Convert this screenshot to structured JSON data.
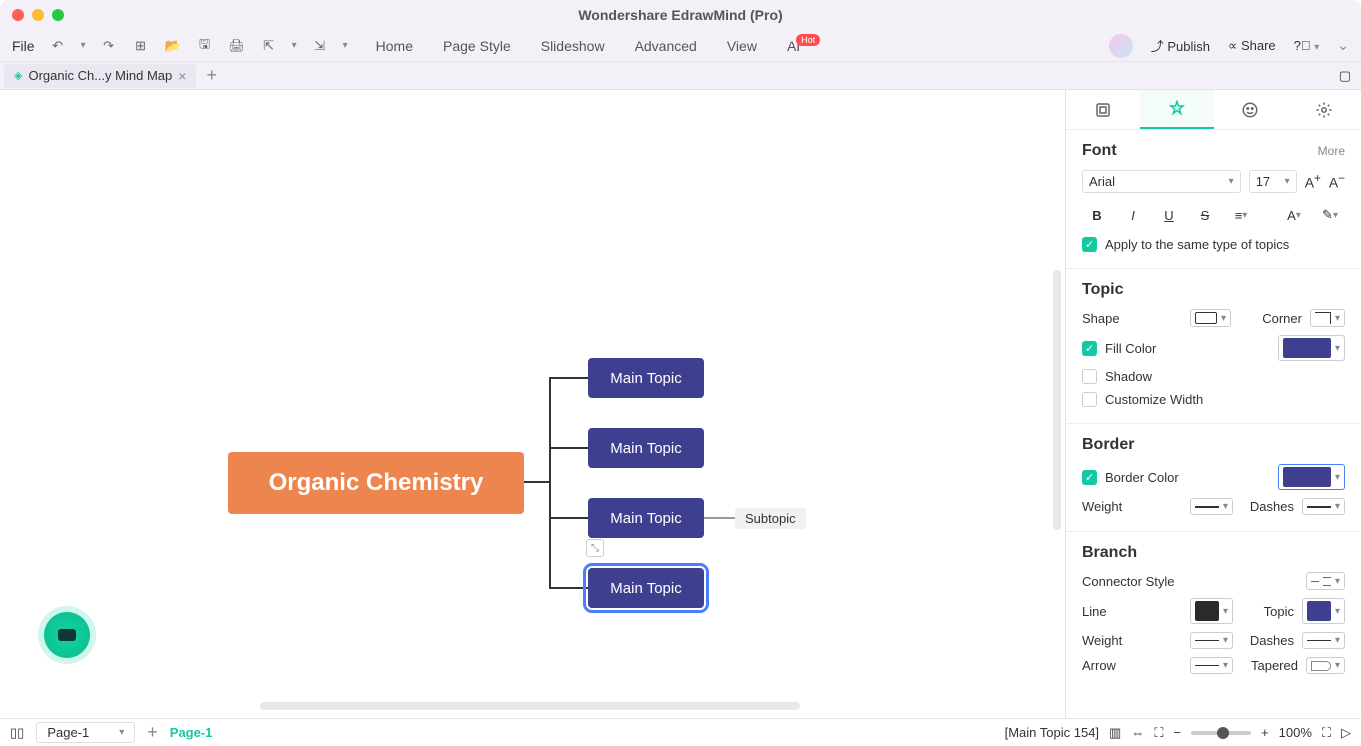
{
  "app": {
    "title": "Wondershare EdrawMind (Pro)"
  },
  "toolbar": {
    "file": "File",
    "menus": [
      "Home",
      "Page Style",
      "Slideshow",
      "Advanced",
      "View",
      "AI"
    ],
    "hot": "Hot",
    "publish": "Publish",
    "share": "Share"
  },
  "tabs": {
    "active": "Organic Ch...y Mind Map"
  },
  "mindmap": {
    "central": "Organic Chemistry",
    "topics": [
      "Main Topic",
      "Main Topic",
      "Main Topic",
      "Main Topic"
    ],
    "subtopic": "Subtopic"
  },
  "sidepanel": {
    "font": {
      "heading": "Font",
      "more": "More",
      "family": "Arial",
      "size": "17",
      "apply_same": "Apply to the same type of topics"
    },
    "topic": {
      "heading": "Topic",
      "shape": "Shape",
      "corner": "Corner",
      "fill_color": "Fill Color",
      "shadow": "Shadow",
      "customize_width": "Customize Width"
    },
    "border": {
      "heading": "Border",
      "border_color": "Border Color",
      "weight": "Weight",
      "dashes": "Dashes"
    },
    "branch": {
      "heading": "Branch",
      "connector": "Connector Style",
      "line": "Line",
      "topic": "Topic",
      "weight": "Weight",
      "dashes": "Dashes",
      "arrow": "Arrow",
      "tapered": "Tapered"
    }
  },
  "colors": {
    "topic_fill": "#3f3f8f",
    "border_color": "#3f3f8f",
    "branch_line": "#2a2a2a",
    "branch_topic": "#3f3f8f"
  },
  "statusbar": {
    "page_label": "Page-1",
    "page_chip": "Page-1",
    "selection": "[Main Topic 154]",
    "zoom": "100%"
  }
}
